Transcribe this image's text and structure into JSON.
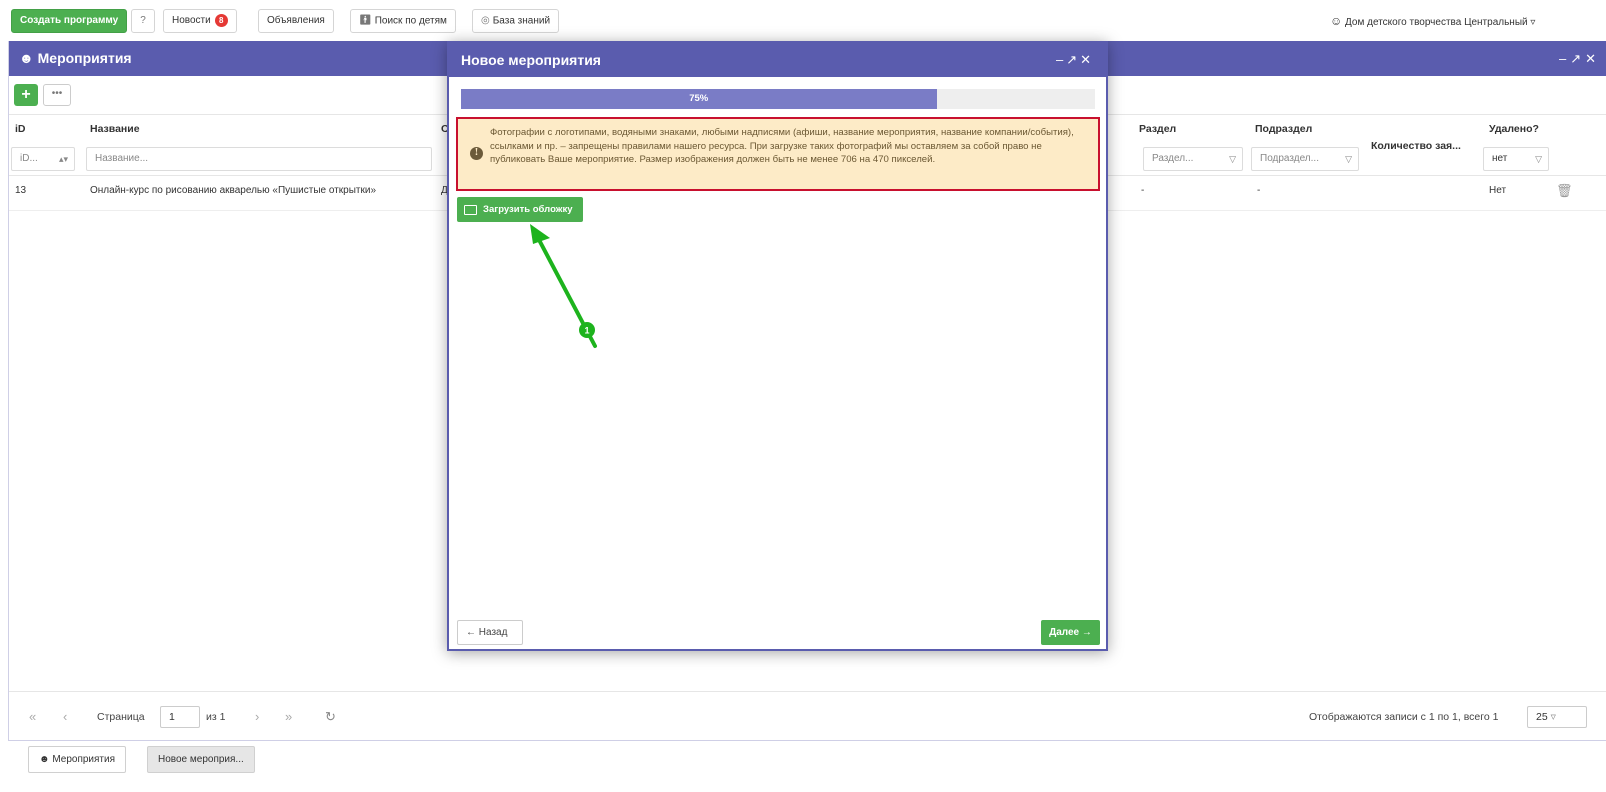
{
  "topbar": {
    "create_label": "Создать программу",
    "help_icon": "question-circle-icon",
    "news_label": "Новости",
    "news_badge": "8",
    "announcements_label": "Объявления",
    "child_search_label": "Поиск по детям",
    "knowledge_label": "База знаний",
    "user_label": "Дом детского творчества Центральный"
  },
  "main": {
    "title": "Мероприятия",
    "columns": {
      "id": "iD",
      "name": "Название",
      "partial": "О",
      "section": "Раздел",
      "subsection": "Подраздел",
      "count": "Количество зая...",
      "deleted": "Удалено?"
    },
    "filters": {
      "id": "iD...",
      "name": "Название...",
      "section": "Раздел...",
      "subsection": "Подраздел...",
      "deleted": "нет"
    },
    "rows": [
      {
        "id": "13",
        "name": "Онлайн-курс по рисованию акварелью «Пушистые открытки»",
        "partial": "Д",
        "section": "-",
        "subsection": "-",
        "deleted": "Нет"
      }
    ],
    "pager": {
      "page_label": "Страница",
      "page": "1",
      "of_label": "из 1",
      "summary": "Отображаются записи с 1 по 1, всего 1",
      "page_size": "25"
    }
  },
  "modal": {
    "title": "Новое мероприятия",
    "progress": 75,
    "progress_label": "75%",
    "warning": "Фотографии с логотипами, водяными знаками, любыми надписями (афиши, название мероприятия, название компании/события), ссылками и пр. – запрещены правилами нашего ресурса. При загрузке таких фотографий мы оставляем за собой право не публиковать Ваше мероприятие. Размер изображения должен быть не менее 706 на 470 пикселей.",
    "upload_label": "Загрузить обложку",
    "back_label": "Назад",
    "next_label": "Далее"
  },
  "annotation": {
    "marker": "1",
    "color": "#1db31d"
  },
  "taskbar": {
    "items": [
      "Мероприятия",
      "Новое мероприя..."
    ]
  },
  "colors": {
    "header": "#5a5cae",
    "accent_green": "#4caf50",
    "warning_bg": "#fdebc7",
    "warning_border": "#c8102e"
  }
}
